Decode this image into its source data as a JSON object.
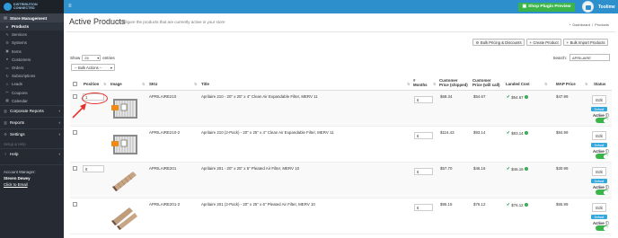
{
  "brand": {
    "logo_text_1": "DISTRIBUTION",
    "logo_text_2": "CONNECTED"
  },
  "sidebar": {
    "store_management": "Store Management",
    "items": [
      {
        "label": "Products",
        "icon": "box-icon",
        "active": true
      },
      {
        "label": "Services",
        "icon": "wrench-icon",
        "active": false
      },
      {
        "label": "Systems",
        "icon": "cog-icon",
        "active": false
      },
      {
        "label": "Items",
        "icon": "tag-icon",
        "active": false
      },
      {
        "label": "Customers",
        "icon": "users-icon",
        "active": false
      },
      {
        "label": "Orders",
        "icon": "cart-icon",
        "active": false
      },
      {
        "label": "Subscriptions",
        "icon": "refresh-icon",
        "active": false
      },
      {
        "label": "Leads",
        "icon": "user-icon",
        "active": false
      },
      {
        "label": "Coupons",
        "icon": "ticket-icon",
        "active": false
      },
      {
        "label": "Calendar",
        "icon": "calendar-icon",
        "active": false
      }
    ],
    "sections": [
      {
        "label": "Corporate Reports",
        "icon": "chart-icon"
      },
      {
        "label": "Reports",
        "icon": "chart-icon"
      },
      {
        "label": "Settings",
        "icon": "gear-icon"
      }
    ],
    "setup_label": "Setup & Help",
    "help_label": "Help",
    "account_manager_label": "Account Manager:",
    "account_manager_name": "Steven Dewey",
    "click_to_email": "Click to Email"
  },
  "topbar": {
    "plugin_button": "Shop Plugin Preview",
    "user_name": "Toolime"
  },
  "header": {
    "title": "Active Products",
    "subtitle": "Configure the products that are currently active in your store",
    "crumb_dashboard": "Dashboard",
    "crumb_products": "Products"
  },
  "toolbar": {
    "bulk_pricing": "Bulk Pricing & Discounts",
    "create_product": "Create Product",
    "bulk_import": "Bulk Import Products"
  },
  "listing": {
    "show_label": "Show",
    "entries_value": "25",
    "entries_label": "entries",
    "bulk_actions": "-- Bulk Actions --",
    "search_label": "Search:",
    "search_value": "APRILAIRE"
  },
  "columns": {
    "position": "Position",
    "image": "Image",
    "sku": "SKU",
    "title": "Title",
    "months_1": "#",
    "months_2": "Months",
    "customer_price_1": "Customer",
    "customer_price_2": "Price (shipped)",
    "customer_will_1": "Customer",
    "customer_will_2": "Price (will call)",
    "landed_cost": "Landed Cost",
    "map_price": "MAP Price",
    "status": "Status"
  },
  "rows": [
    {
      "position": "1",
      "sku": "APRILAIRE210",
      "title": "Aprilaire 210 - 20\" x 25\" x 4\" Clean Air Expandable Filter, MERV 11",
      "months": "6",
      "price_shipped": "$68.34",
      "price_will_call": "$54.67",
      "landed_cost": "$54.67",
      "map_price": "$47.99",
      "edit": "Edit",
      "badge": "Default",
      "active": "Active"
    },
    {
      "position": "",
      "sku": "APRILAIRE210-2",
      "title": "Aprilaire 210 (2-Pack) - 20\" x 25\" x 4\" Clean Air Expandable Filter, MERV 11",
      "months": "6",
      "price_shipped": "$116.43",
      "price_will_call": "$93.14",
      "landed_cost": "$93.14",
      "map_price": "$84.99",
      "edit": "Edit",
      "badge": "Default",
      "active": "Active"
    },
    {
      "position": "8",
      "sku": "APRILAIRE201",
      "title": "Aprilaire 201 - 20\" x 25\" x 6\" Pleated Air Filter, MERV 10",
      "months": "6",
      "price_shipped": "$57.70",
      "price_will_call": "$46.16",
      "landed_cost": "$46.16",
      "map_price": "$30.99",
      "edit": "Edit",
      "badge": "Default",
      "active": "Active"
    },
    {
      "position": "",
      "sku": "APRILAIRE201-2",
      "title": "Aprilaire 201 (2-Pack) - 20\" x 25\" x 6\" Pleated Air Filter, MERV 10",
      "months": "6",
      "price_shipped": "$95.15",
      "price_will_call": "$76.12",
      "landed_cost": "$76.12",
      "map_price": "$55.99",
      "edit": "Edit",
      "badge": "Default",
      "active": "Active"
    }
  ],
  "colors": {
    "topbar": "#2e8fcd",
    "sidebar": "#262b33",
    "success": "#3bb54a",
    "annotation": "#e6322e"
  }
}
